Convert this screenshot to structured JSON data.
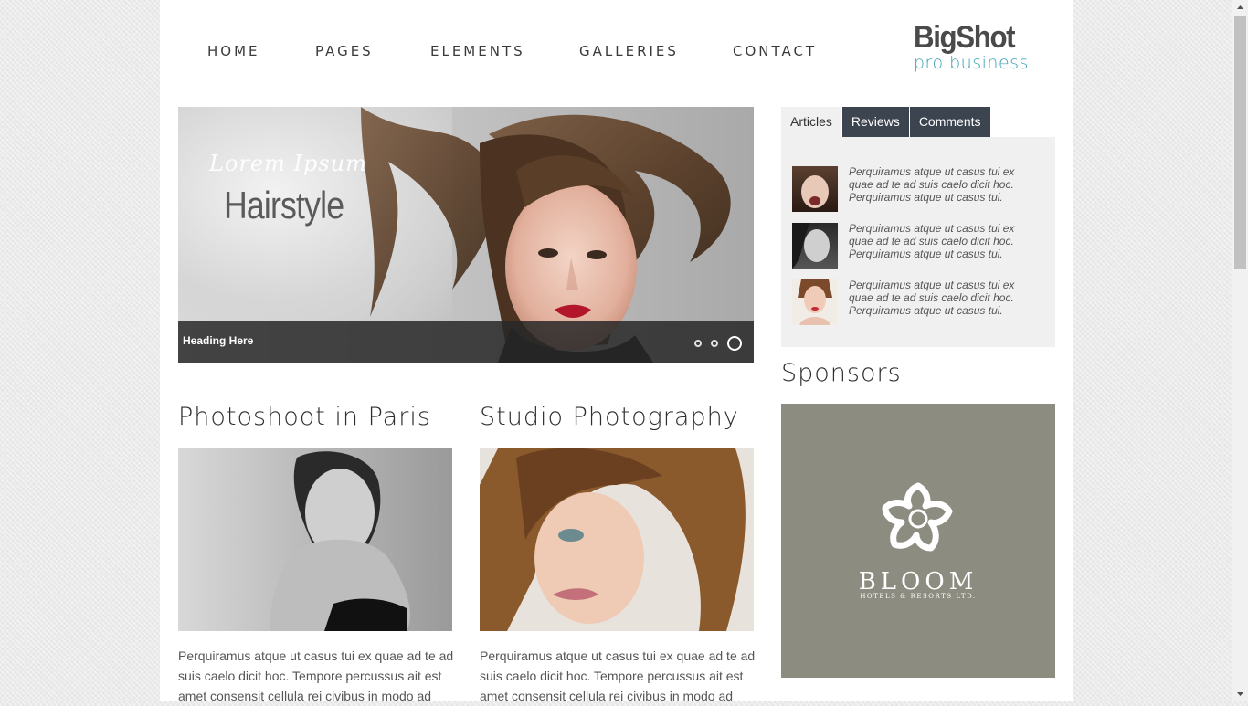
{
  "nav": {
    "items": [
      {
        "label": "HOME"
      },
      {
        "label": "PAGES"
      },
      {
        "label": "ELEMENTS"
      },
      {
        "label": "GALLERIES"
      },
      {
        "label": "CONTACT"
      }
    ]
  },
  "logo": {
    "main": "BigShot",
    "sub": "pro business"
  },
  "slider": {
    "caption_small": "Lorem Ipsum",
    "caption_big": "Hairstyle",
    "heading": "Heading Here",
    "dots": 3,
    "active_dot": 3
  },
  "articles": [
    {
      "title": "Photoshoot in Paris",
      "text": "Perquiramus atque ut casus tui ex quae ad te ad suis caelo dicit hoc. Tempore percussus ait est amet consensit cellula rei civibus in modo ad"
    },
    {
      "title": "Studio Photography",
      "text": "Perquiramus atque ut casus tui ex quae ad te ad suis caelo dicit hoc. Tempore percussus ait est amet consensit cellula rei civibus in modo ad"
    }
  ],
  "tabs": {
    "labels": [
      "Articles",
      "Reviews",
      "Comments"
    ],
    "active": "Articles",
    "items": [
      {
        "text": "Perquiramus atque ut casus tui ex quae ad te ad suis caelo dicit hoc. Perquiramus atque ut casus tui."
      },
      {
        "text": "Perquiramus atque ut casus tui ex quae ad te ad suis caelo dicit hoc. Perquiramus atque ut casus tui."
      },
      {
        "text": "Perquiramus atque ut casus tui ex quae ad te ad suis caelo dicit hoc. Perquiramus atque ut casus tui."
      }
    ]
  },
  "sponsors": {
    "title": "Sponsors",
    "name": "BLOOM",
    "subtitle": "HOTELS & RESORTS LTD."
  },
  "colors": {
    "tab_dark": "#3c4450",
    "logo_accent": "#3aa0b6",
    "sponsor_bg": "#8c8c80"
  }
}
